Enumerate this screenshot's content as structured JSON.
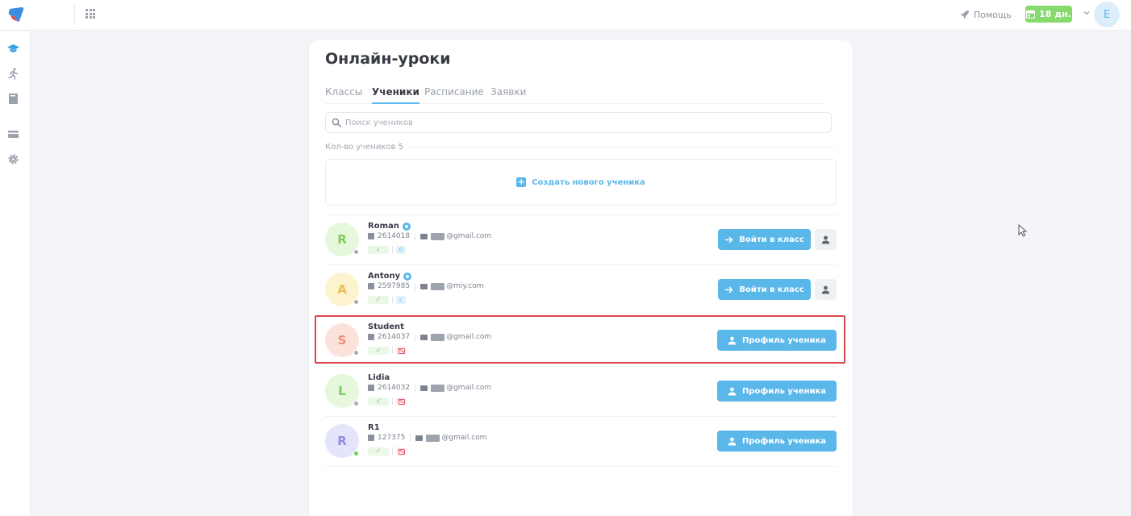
{
  "topbar": {
    "help_label": "Помощь",
    "trial_label": "18 дн.",
    "user_initial": "E"
  },
  "page": {
    "title": "Онлайн-уроки",
    "tabs": [
      {
        "label": "Классы",
        "active": false
      },
      {
        "label": "Ученики",
        "active": true
      },
      {
        "label": "Расписание",
        "active": false
      },
      {
        "label": "Заявки",
        "active": false
      }
    ],
    "search_placeholder": "Поиск учеников",
    "count_label": "Кол-во учеников 5",
    "create_label": "Создать нового ученика"
  },
  "buttons": {
    "enter_class": "Войти в класс",
    "profile": "Профиль ученика"
  },
  "students": [
    {
      "name": "Roman",
      "initial": "R",
      "id": "2614018",
      "email_suffix": "@gmail.com",
      "tag": "0",
      "verified": true,
      "status": "offline"
    },
    {
      "name": "Antony",
      "initial": "A",
      "id": "2597985",
      "email_suffix": "@miy.com",
      "tag": "c",
      "verified": true,
      "status": "offline"
    },
    {
      "name": "Student",
      "initial": "S",
      "id": "2614037",
      "email_suffix": "@gmail.com",
      "verified": false,
      "status": "offline"
    },
    {
      "name": "Lidia",
      "initial": "L",
      "id": "2614032",
      "email_suffix": "@gmail.com",
      "verified": false,
      "status": "offline"
    },
    {
      "name": "R1",
      "initial": "R",
      "id": "127375",
      "email_suffix": "@gmail.com",
      "verified": false,
      "status": "online"
    }
  ],
  "colors": {
    "accent": "#5ab7ea",
    "trial_green": "#86d96d",
    "highlight_red": "#d94a4f"
  }
}
